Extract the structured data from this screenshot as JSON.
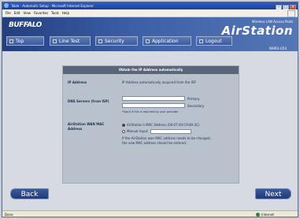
{
  "window": {
    "title": "Table - Automatic Setup - Microsoft Internet Explorer",
    "menu": [
      "File",
      "Edit",
      "View",
      "Favorites",
      "Tools",
      "Help"
    ]
  },
  "header": {
    "logo": "BUFFALO",
    "brand_sub": "Wireless LAN Access Point",
    "brand_main": "AirStation",
    "model": "WHR3-G54"
  },
  "tabs": [
    "Top",
    "Line Test",
    "Security",
    "Application",
    "Logout"
  ],
  "panel": {
    "title": "Obtain the IP Address automatically",
    "ip_label": "IP Address",
    "ip_value": "IP Address automatically acquired from the ISP",
    "dns_label": "DNS Servers (from ISP)",
    "primary": "Primary",
    "secondary": "Secondary",
    "dns_note": "*Input if this is required by your provider",
    "mac_label_1": "AirStation WAN MAC",
    "mac_label_2": "Address",
    "mac_option_default": "AirStation's MAC Address (00:07:40:C9:8A:3C)",
    "mac_option_manual": "Manual Input:",
    "mac_note_1": "If the AirStation wan MAC address needs to be changed,",
    "mac_note_2": "the new MAC address should be entered."
  },
  "nav": {
    "back": "Back",
    "next": "Next"
  },
  "status": {
    "left": "Done",
    "right": "Internet"
  }
}
